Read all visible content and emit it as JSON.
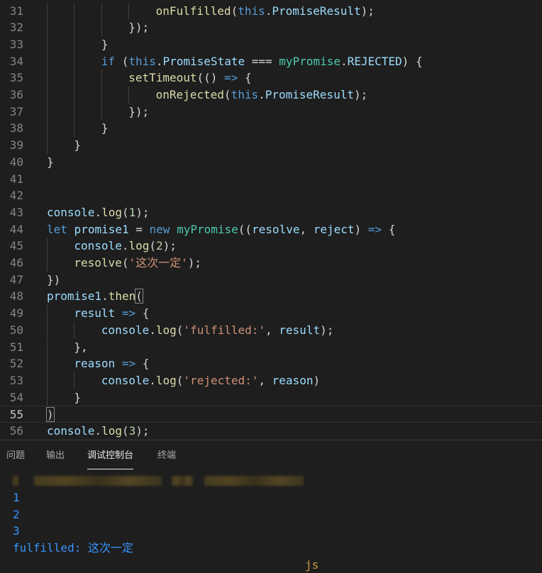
{
  "editor": {
    "active_line": 55,
    "lines": [
      {
        "num": 31,
        "indent": 4,
        "tokens": [
          {
            "t": "fn",
            "v": "onFulfilled"
          },
          {
            "t": "pun",
            "v": "("
          },
          {
            "t": "kw",
            "v": "this"
          },
          {
            "t": "pun",
            "v": "."
          },
          {
            "t": "var",
            "v": "PromiseResult"
          },
          {
            "t": "pun",
            "v": ");"
          }
        ]
      },
      {
        "num": 32,
        "indent": 3,
        "tokens": [
          {
            "t": "pun",
            "v": "});"
          }
        ]
      },
      {
        "num": 33,
        "indent": 2,
        "tokens": [
          {
            "t": "pun",
            "v": "}"
          }
        ]
      },
      {
        "num": 34,
        "indent": 2,
        "tokens": [
          {
            "t": "kw",
            "v": "if"
          },
          {
            "t": "pun",
            "v": " ("
          },
          {
            "t": "kw",
            "v": "this"
          },
          {
            "t": "pun",
            "v": "."
          },
          {
            "t": "var",
            "v": "PromiseState"
          },
          {
            "t": "pun",
            "v": " === "
          },
          {
            "t": "cls",
            "v": "myPromise"
          },
          {
            "t": "pun",
            "v": "."
          },
          {
            "t": "var",
            "v": "REJECTED"
          },
          {
            "t": "pun",
            "v": ") {"
          }
        ]
      },
      {
        "num": 35,
        "indent": 3,
        "tokens": [
          {
            "t": "fn",
            "v": "setTimeout"
          },
          {
            "t": "pun",
            "v": "(() "
          },
          {
            "t": "kw",
            "v": "=>"
          },
          {
            "t": "pun",
            "v": " {"
          }
        ]
      },
      {
        "num": 36,
        "indent": 4,
        "tokens": [
          {
            "t": "fn",
            "v": "onRejected"
          },
          {
            "t": "pun",
            "v": "("
          },
          {
            "t": "kw",
            "v": "this"
          },
          {
            "t": "pun",
            "v": "."
          },
          {
            "t": "var",
            "v": "PromiseResult"
          },
          {
            "t": "pun",
            "v": ");"
          }
        ]
      },
      {
        "num": 37,
        "indent": 3,
        "tokens": [
          {
            "t": "pun",
            "v": "});"
          }
        ]
      },
      {
        "num": 38,
        "indent": 2,
        "tokens": [
          {
            "t": "pun",
            "v": "}"
          }
        ]
      },
      {
        "num": 39,
        "indent": 1,
        "tokens": [
          {
            "t": "pun",
            "v": "}"
          }
        ]
      },
      {
        "num": 40,
        "indent": 0,
        "tokens": [
          {
            "t": "pun",
            "v": "}"
          }
        ]
      },
      {
        "num": 41,
        "indent": 0,
        "tokens": []
      },
      {
        "num": 42,
        "indent": 0,
        "tokens": []
      },
      {
        "num": 43,
        "indent": 0,
        "tokens": [
          {
            "t": "var",
            "v": "console"
          },
          {
            "t": "pun",
            "v": "."
          },
          {
            "t": "fn",
            "v": "log"
          },
          {
            "t": "pun",
            "v": "("
          },
          {
            "t": "num",
            "v": "1"
          },
          {
            "t": "pun",
            "v": ");"
          }
        ]
      },
      {
        "num": 44,
        "indent": 0,
        "tokens": [
          {
            "t": "kw",
            "v": "let"
          },
          {
            "t": "pun",
            "v": " "
          },
          {
            "t": "var",
            "v": "promise1"
          },
          {
            "t": "pun",
            "v": " = "
          },
          {
            "t": "kw",
            "v": "new"
          },
          {
            "t": "pun",
            "v": " "
          },
          {
            "t": "cls",
            "v": "myPromise"
          },
          {
            "t": "pun",
            "v": "(("
          },
          {
            "t": "var",
            "v": "resolve"
          },
          {
            "t": "pun",
            "v": ", "
          },
          {
            "t": "var",
            "v": "reject"
          },
          {
            "t": "pun",
            "v": ") "
          },
          {
            "t": "kw",
            "v": "=>"
          },
          {
            "t": "pun",
            "v": " {"
          }
        ]
      },
      {
        "num": 45,
        "indent": 1,
        "tokens": [
          {
            "t": "var",
            "v": "console"
          },
          {
            "t": "pun",
            "v": "."
          },
          {
            "t": "fn",
            "v": "log"
          },
          {
            "t": "pun",
            "v": "("
          },
          {
            "t": "num",
            "v": "2"
          },
          {
            "t": "pun",
            "v": ");"
          }
        ]
      },
      {
        "num": 46,
        "indent": 1,
        "tokens": [
          {
            "t": "fn",
            "v": "resolve"
          },
          {
            "t": "pun",
            "v": "("
          },
          {
            "t": "str",
            "v": "'这次一定'"
          },
          {
            "t": "pun",
            "v": ");"
          }
        ]
      },
      {
        "num": 47,
        "indent": 0,
        "tokens": [
          {
            "t": "pun",
            "v": "})"
          }
        ]
      },
      {
        "num": 48,
        "indent": 0,
        "tokens": [
          {
            "t": "var",
            "v": "promise1"
          },
          {
            "t": "pun",
            "v": "."
          },
          {
            "t": "fn",
            "v": "then"
          },
          {
            "t": "box",
            "v": "("
          }
        ]
      },
      {
        "num": 49,
        "indent": 1,
        "tokens": [
          {
            "t": "var",
            "v": "result"
          },
          {
            "t": "pun",
            "v": " "
          },
          {
            "t": "kw",
            "v": "=>"
          },
          {
            "t": "pun",
            "v": " {"
          }
        ]
      },
      {
        "num": 50,
        "indent": 2,
        "tokens": [
          {
            "t": "var",
            "v": "console"
          },
          {
            "t": "pun",
            "v": "."
          },
          {
            "t": "fn",
            "v": "log"
          },
          {
            "t": "pun",
            "v": "("
          },
          {
            "t": "str",
            "v": "'fulfilled:'"
          },
          {
            "t": "pun",
            "v": ", "
          },
          {
            "t": "var",
            "v": "result"
          },
          {
            "t": "pun",
            "v": ");"
          }
        ]
      },
      {
        "num": 51,
        "indent": 1,
        "tokens": [
          {
            "t": "pun",
            "v": "},"
          }
        ]
      },
      {
        "num": 52,
        "indent": 1,
        "tokens": [
          {
            "t": "var",
            "v": "reason"
          },
          {
            "t": "pun",
            "v": " "
          },
          {
            "t": "kw",
            "v": "=>"
          },
          {
            "t": "pun",
            "v": " {"
          }
        ]
      },
      {
        "num": 53,
        "indent": 2,
        "tokens": [
          {
            "t": "var",
            "v": "console"
          },
          {
            "t": "pun",
            "v": "."
          },
          {
            "t": "fn",
            "v": "log"
          },
          {
            "t": "pun",
            "v": "("
          },
          {
            "t": "str",
            "v": "'rejected:'"
          },
          {
            "t": "pun",
            "v": ", "
          },
          {
            "t": "var",
            "v": "reason"
          },
          {
            "t": "pun",
            "v": ")"
          }
        ]
      },
      {
        "num": 54,
        "indent": 1,
        "tokens": [
          {
            "t": "pun",
            "v": "}"
          }
        ]
      },
      {
        "num": 55,
        "indent": 0,
        "tokens": [
          {
            "t": "box",
            "v": ")"
          }
        ]
      },
      {
        "num": 56,
        "indent": 0,
        "tokens": [
          {
            "t": "var",
            "v": "console"
          },
          {
            "t": "pun",
            "v": "."
          },
          {
            "t": "fn",
            "v": "log"
          },
          {
            "t": "pun",
            "v": "("
          },
          {
            "t": "num",
            "v": "3"
          },
          {
            "t": "pun",
            "v": ");"
          }
        ]
      }
    ]
  },
  "panel": {
    "tabs": [
      {
        "label": "问题",
        "active": false
      },
      {
        "label": "输出",
        "active": false
      },
      {
        "label": "调试控制台",
        "active": true
      },
      {
        "label": "终端",
        "active": false
      }
    ],
    "console": {
      "path_suffix": "js",
      "lines": [
        "1",
        "2",
        "3",
        "fulfilled: 这次一定"
      ]
    }
  },
  "colors": {
    "background": "#1e1e1e",
    "console_text": "#3794ff",
    "path_text": "#c79b3d"
  }
}
